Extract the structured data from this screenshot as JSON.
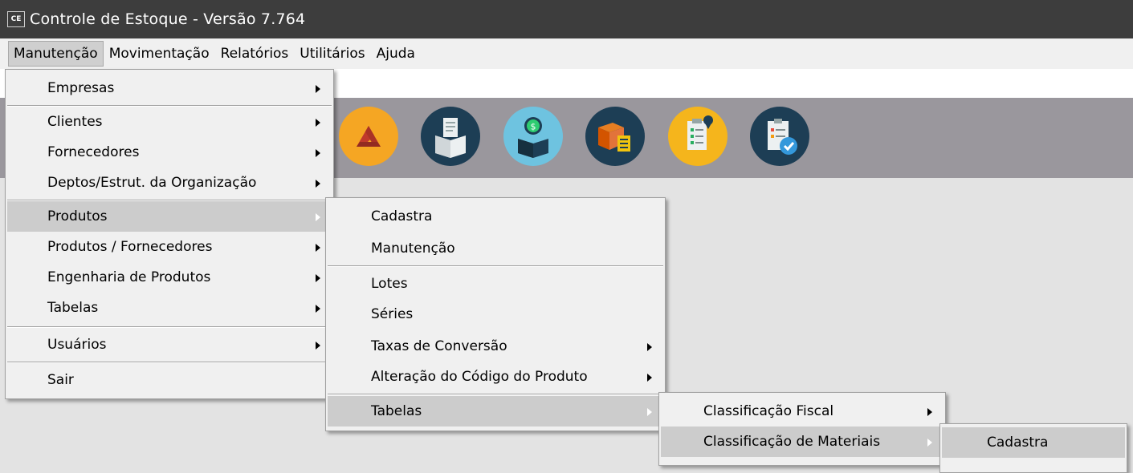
{
  "window": {
    "title": "Controle de Estoque - Versão 7.764",
    "icon_text": "CE"
  },
  "menubar": {
    "items": [
      {
        "label": "Manutenção",
        "active": true
      },
      {
        "label": "Movimentação"
      },
      {
        "label": "Relatórios"
      },
      {
        "label": "Utilitários"
      },
      {
        "label": "Ajuda"
      }
    ]
  },
  "toolbar": {
    "icons": [
      {
        "name": "drive-icon",
        "color": "#f5a623"
      },
      {
        "name": "open-box-document-icon",
        "color": "#1d3e55"
      },
      {
        "name": "box-money-icon",
        "color": "#6ec3e0"
      },
      {
        "name": "box-checklist-icon",
        "color": "#1d3e55"
      },
      {
        "name": "clipboard-location-icon",
        "color": "#f5b51c"
      },
      {
        "name": "report-check-icon",
        "color": "#1d3e55"
      }
    ]
  },
  "menus": {
    "manutencao": {
      "items": [
        {
          "label": "Empresas",
          "submenu": true
        },
        {
          "label": "Clientes",
          "submenu": true
        },
        {
          "label": "Fornecedores",
          "submenu": true
        },
        {
          "label": "Deptos/Estrut. da Organização",
          "submenu": true
        },
        {
          "label": "Produtos",
          "submenu": true,
          "highlighted": true
        },
        {
          "label": "Produtos / Fornecedores",
          "submenu": true
        },
        {
          "label": "Engenharia de Produtos",
          "submenu": true
        },
        {
          "label": "Tabelas",
          "submenu": true
        },
        {
          "label": "Usuários",
          "submenu": true
        },
        {
          "label": "Sair",
          "submenu": false
        }
      ]
    },
    "produtos": {
      "items": [
        {
          "label": "Cadastra",
          "submenu": false
        },
        {
          "label": "Manutenção",
          "submenu": false
        },
        {
          "label": "Lotes",
          "submenu": false
        },
        {
          "label": "Séries",
          "submenu": false
        },
        {
          "label": "Taxas de Conversão",
          "submenu": true
        },
        {
          "label": "Alteração do Código do Produto",
          "submenu": true
        },
        {
          "label": "Tabelas",
          "submenu": true,
          "highlighted": true
        }
      ]
    },
    "tabelas": {
      "items": [
        {
          "label": "Classificação Fiscal",
          "submenu": true
        },
        {
          "label": "Classificação de Materiais",
          "submenu": true,
          "highlighted": true
        }
      ]
    },
    "classificacao_materiais": {
      "items": [
        {
          "label": "Cadastra",
          "submenu": false,
          "highlighted": true
        }
      ]
    }
  }
}
